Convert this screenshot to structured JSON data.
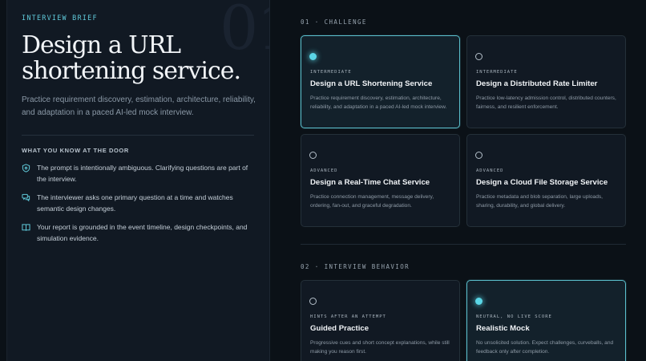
{
  "brief": {
    "watermark": "01",
    "eyebrow": "INTERVIEW BRIEF",
    "title": "Design a URL shortening service.",
    "description": "Practice requirement discovery, estimation, architecture, reliability, and adaptation in a paced AI-led mock interview.",
    "know_title": "WHAT YOU KNOW AT THE DOOR",
    "items": [
      {
        "icon": "shield-icon",
        "text": "The prompt is intentionally ambiguous. Clarifying questions are part of the interview."
      },
      {
        "icon": "chat-icon",
        "text": "The interviewer asks one primary question at a time and watches semantic design changes."
      },
      {
        "icon": "book-icon",
        "text": "Your report is grounded in the event timeline, design checkpoints, and simulation evidence."
      }
    ]
  },
  "challenge": {
    "label": "01 · CHALLENGE",
    "cards": [
      {
        "level": "INTERMEDIATE",
        "title": "Design a URL Shortening Service",
        "desc": "Practice requirement discovery, estimation, architecture, reliability, and adaptation in a paced AI-led mock interview.",
        "selected": true
      },
      {
        "level": "INTERMEDIATE",
        "title": "Design a Distributed Rate Limiter",
        "desc": "Practice low-latency admission control, distributed counters, fairness, and resilient enforcement.",
        "selected": false
      },
      {
        "level": "ADVANCED",
        "title": "Design a Real-Time Chat Service",
        "desc": "Practice connection management, message delivery, ordering, fan-out, and graceful degradation.",
        "selected": false
      },
      {
        "level": "ADVANCED",
        "title": "Design a Cloud File Storage Service",
        "desc": "Practice metadata and blob separation, large uploads, sharing, durability, and global delivery.",
        "selected": false
      }
    ]
  },
  "behavior": {
    "label": "02 · INTERVIEW BEHAVIOR",
    "cards": [
      {
        "level": "HINTS AFTER AN ATTEMPT",
        "title": "Guided Practice",
        "desc": "Progressive cues and short concept explanations, while still making you reason first.",
        "selected": false
      },
      {
        "level": "NEUTRAL, NO LIVE SCORE",
        "title": "Realistic Mock",
        "desc": "No unsolicited solution. Expect challenges, curveballs, and feedback only after completion.",
        "selected": true
      }
    ]
  },
  "colors": {
    "accent": "#5bbfcc",
    "background": "#0b1117",
    "panel": "#111923"
  }
}
